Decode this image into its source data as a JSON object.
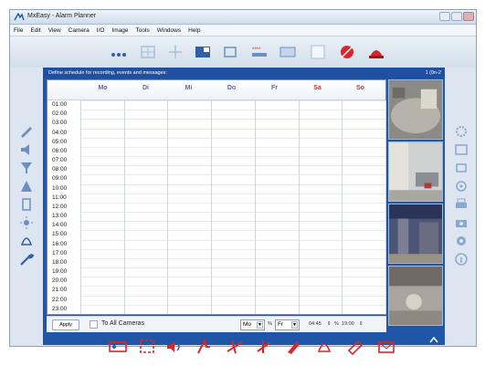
{
  "window": {
    "title": "MxEasy - Alarm Planner"
  },
  "menu": [
    "File",
    "Edit",
    "View",
    "Camera",
    "I/O",
    "Image",
    "Tools",
    "Windows",
    "Help"
  ],
  "schedule": {
    "header": "Define schedule for recording, events and messages:",
    "pager": "1 (0n-2",
    "days": [
      "Mo",
      "Di",
      "Mi",
      "Do",
      "Fr",
      "Sa",
      "So"
    ],
    "weekend_days": [
      "Sa",
      "So"
    ],
    "hours": [
      "01:00",
      "02:00",
      "03:00",
      "04:00",
      "05:00",
      "06:00",
      "07:00",
      "08:00",
      "09:00",
      "10:00",
      "11:00",
      "12:00",
      "13:00",
      "14:00",
      "15:00",
      "16:00",
      "17:00",
      "18:00",
      "19:00",
      "20:00",
      "21:00",
      "22:00",
      "23:00"
    ]
  },
  "footer": {
    "apply_label": "Apply",
    "to_all_cameras_label": "To All Cameras",
    "from_day": "Mo",
    "to_sep_1": "%",
    "to_day": "Fr",
    "from_time": "04:45",
    "to_sep_2": "%",
    "to_time": "19:00"
  },
  "colors": {
    "accent_blue": "#1f56a8",
    "weekend_red": "#d02a2a",
    "weekday_label": "#5b6aa0",
    "icon_blue": "#3b7fd0",
    "icon_red": "#d8262c"
  }
}
